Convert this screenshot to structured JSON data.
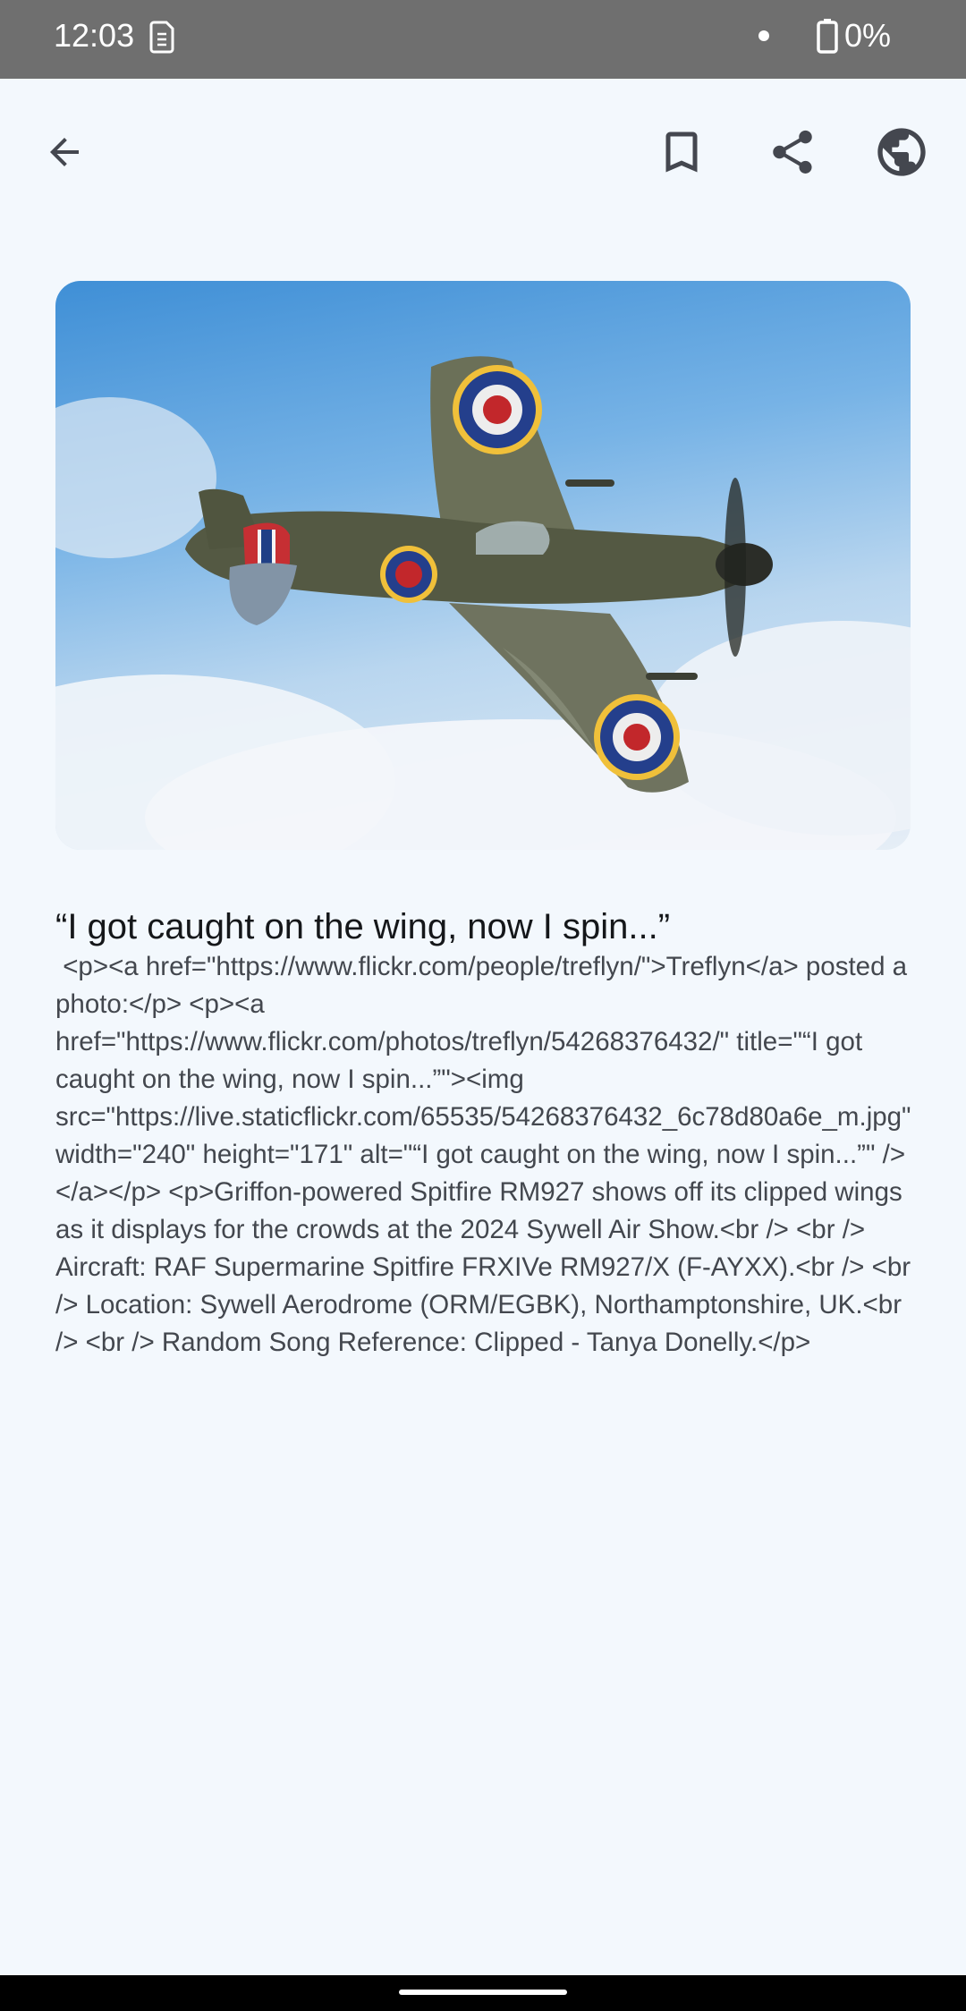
{
  "status_bar": {
    "time": "12:03",
    "battery": "0%"
  },
  "toolbar": {
    "back_icon": "arrow-left-icon",
    "bookmark_icon": "bookmark-icon",
    "share_icon": "share-icon",
    "globe_icon": "globe-icon"
  },
  "article": {
    "title": "“I got caught on the wing, now I spin...”",
    "body": " <p><a href=\"https://www.flickr.com/people/treflyn/\">Treflyn</a> posted a photo:</p> <p><a href=\"https://www.flickr.com/photos/treflyn/54268376432/\" title=\"“I got caught on the wing, now I spin...”\"><img src=\"https://live.staticflickr.com/65535/54268376432_6c78d80a6e_m.jpg\" width=\"240\" height=\"171\" alt=\"“I got caught on the wing, now I spin...”\" /></a></p> <p>Griffon-powered Spitfire RM927 shows off its clipped wings as it displays for the crowds at the 2024 Sywell Air Show.<br /> <br /> Aircraft: RAF Supermarine Spitfire FRXIVe RM927/X (F-AYXX).<br /> <br /> Location: Sywell Aerodrome (ORM/EGBK), Northamptonshire, UK.<br /> <br /> Random Song Reference: Clipped - Tanya Donelly.</p>"
  },
  "colors": {
    "background": "#f3f8fd",
    "status_bar": "#6f6f6f",
    "icon": "#44474f",
    "title_text": "#15171a",
    "body_text": "#43474e"
  }
}
